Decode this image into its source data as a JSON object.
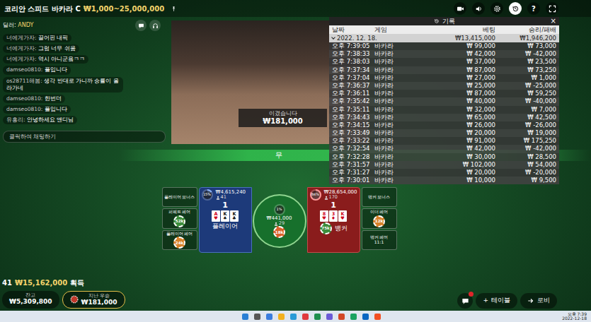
{
  "top_bar": {
    "title": "코리안 스피드 바카라 C",
    "limits": "₩1,000~25,000,000",
    "help": "?",
    "history_open": true
  },
  "chat": {
    "dealer_label": "딜러:",
    "dealer_name": "ANDY",
    "messages": [
      {
        "user": "너에게가자:",
        "text": "끌어핀 내픽"
      },
      {
        "user": "너에게가자:",
        "text": "그럼 너무 쉬움"
      },
      {
        "user": "너에게가자:",
        "text": "역시 아니군욬ㅋㅋ"
      },
      {
        "user": "damseo0810:",
        "text": "플입니다"
      },
      {
        "user": "os28711해봄:",
        "text": "생각 반대로 가니까 승률이 올라가네"
      },
      {
        "user": "damseo0810:",
        "text": "한번더"
      },
      {
        "user": "damseo0810:",
        "text": "플입니다"
      },
      {
        "user": "유흥리:",
        "text": "안녕하세요 앤디님"
      }
    ],
    "placeholder": "클릭하여 채팅하기"
  },
  "video": {
    "win_label": "이겼습니다",
    "win_amount": "₩181,000"
  },
  "result_band": {
    "text": "무"
  },
  "history": {
    "title": "기록",
    "close": "×",
    "columns": [
      "날짜",
      "게임",
      "베팅",
      "승리/패배"
    ],
    "summary": {
      "date": "2022. 12. 18.",
      "expanded": true,
      "bet": "₩13,415,000",
      "result": "₩1,946,200"
    },
    "rows": [
      [
        "오후 7:39:05",
        "바카라",
        "₩ 99,000",
        "₩ 73,000"
      ],
      [
        "오후 7:38:33",
        "바카라",
        "₩ 42,000",
        "₩ -42,000"
      ],
      [
        "오후 7:38:03",
        "바카라",
        "₩ 37,000",
        "₩ 23,500"
      ],
      [
        "오후 7:37:34",
        "바카라",
        "₩ 87,000",
        "₩ 73,250"
      ],
      [
        "오후 7:37:04",
        "바카라",
        "₩ 27,000",
        "₩ 1,000"
      ],
      [
        "오후 7:36:37",
        "바카라",
        "₩ 25,000",
        "₩ -25,000"
      ],
      [
        "오후 7:36:11",
        "바카라",
        "₩ 87,000",
        "₩ 59,250"
      ],
      [
        "오후 7:35:42",
        "바카라",
        "₩ 40,000",
        "₩ -40,000"
      ],
      [
        "오후 7:35:11",
        "바카라",
        "₩ 32,000",
        "₩ 7,000"
      ],
      [
        "오후 7:34:43",
        "바카라",
        "₩ 65,000",
        "₩ 42,500"
      ],
      [
        "오후 7:34:15",
        "바카라",
        "₩ 26,000",
        "₩ -26,000"
      ],
      [
        "오후 7:33:49",
        "바카라",
        "₩ 20,000",
        "₩ 19,000"
      ],
      [
        "오후 7:33:22",
        "바카라",
        "₩ 91,000",
        "₩ 175,250"
      ],
      [
        "오후 7:32:54",
        "바카라",
        "₩ 42,000",
        "₩ -42,000"
      ],
      [
        "오후 7:32:28",
        "바카라",
        "₩ 30,000",
        "₩ 28,500"
      ],
      [
        "오후 7:31:57",
        "바카라",
        "₩ 102,000",
        "₩ 54,000"
      ],
      [
        "오후 7:31:27",
        "바카라",
        "₩ 20,000",
        "₩ -20,000"
      ],
      [
        "오후 7:30:01",
        "바카라",
        "₩ 10,000",
        "₩ 9,500"
      ]
    ]
  },
  "side_bets": {
    "left": [
      {
        "label": "플레이어 보너스"
      },
      {
        "label": "퍼펙트 페어",
        "chip": {
          "value": "52k",
          "color": "#3c8d3c"
        }
      },
      {
        "label": "플레이어 페어",
        "chip": {
          "value": "24k",
          "color": "#d7812a"
        }
      }
    ],
    "right": [
      {
        "label": "뱅커 보너스"
      },
      {
        "label": "이더 페어",
        "chip": {
          "value": "12k",
          "color": "#d7812a"
        }
      },
      {
        "label": "뱅커 페어",
        "odds": "11:1"
      }
    ]
  },
  "main_bets": {
    "player": {
      "label": "플레이어",
      "amount": "₩4,615,240",
      "players": "41",
      "level": 0.15,
      "reading": "15%",
      "score": "1",
      "cards": [
        {
          "rank": "A",
          "suit": "♥",
          "color": "#d0021b"
        },
        {
          "rank": "K",
          "suit": "♠",
          "color": "#111111"
        },
        {
          "rank": "K",
          "suit": "♣",
          "color": "#111111"
        }
      ]
    },
    "tie": {
      "amount": "₩441,000",
      "players": "29",
      "level": 0.01,
      "reading": "1%",
      "chip": {
        "value": "18k",
        "color": "#d9622b"
      }
    },
    "banker": {
      "label": "뱅커",
      "amount": "₩28,654,000",
      "players": "170",
      "level": 0.84,
      "reading": "84%",
      "score": "1",
      "cards": [
        {
          "rank": "8",
          "suit": "♥",
          "color": "#d0021b"
        },
        {
          "rank": "3",
          "suit": "♦",
          "color": "#d0021b"
        },
        {
          "rank": "K",
          "suit": "♥",
          "color": "#d0021b"
        }
      ],
      "chip": {
        "value": "75k",
        "color": "#3c8d3c"
      }
    }
  },
  "bottom": {
    "winners": "41",
    "total_won": "₩15,162,000",
    "won_label": "획득",
    "balance": {
      "label": "잔고",
      "value": "₩5,309,800"
    },
    "last_win": {
      "label": "지난 우승",
      "value": "₩181,000"
    },
    "chat_unread": true,
    "table_button": {
      "icon": "+",
      "label": "테이블"
    },
    "lobby_button": "로비"
  },
  "taskbar": {
    "time": "오후 7:39",
    "date": "2022-12-18"
  }
}
